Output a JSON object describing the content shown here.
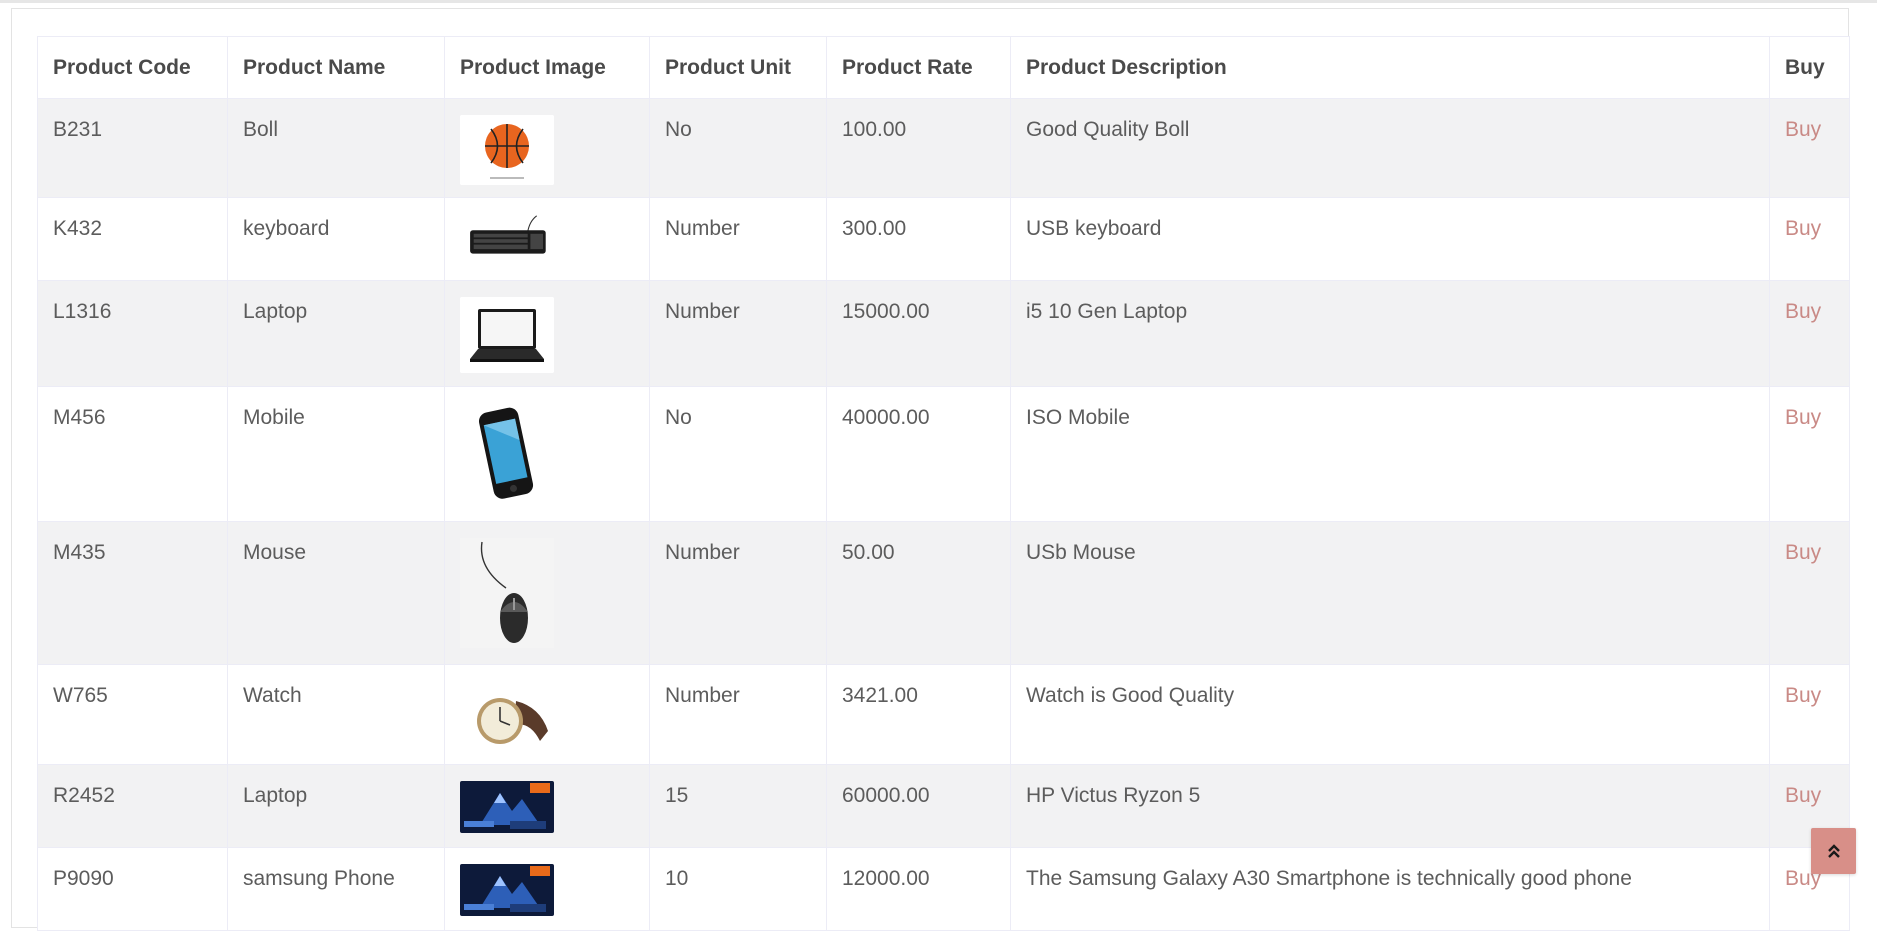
{
  "table": {
    "headers": [
      "Product Code",
      "Product Name",
      "Product Image",
      "Product Unit",
      "Product Rate",
      "Product Description",
      "Buy"
    ],
    "rows": [
      {
        "code": "B231",
        "name": "Boll",
        "image": "basketball",
        "unit": "No",
        "rate": "100.00",
        "description": "Good Quality Boll",
        "buy": "Buy"
      },
      {
        "code": "K432",
        "name": "keyboard",
        "image": "keyboard",
        "unit": "Number",
        "rate": "300.00",
        "description": "USB keyboard",
        "buy": "Buy"
      },
      {
        "code": "L1316",
        "name": "Laptop",
        "image": "laptop",
        "unit": "Number",
        "rate": "15000.00",
        "description": "i5 10 Gen Laptop",
        "buy": "Buy"
      },
      {
        "code": "M456",
        "name": "Mobile",
        "image": "smartphone",
        "unit": "No",
        "rate": "40000.00",
        "description": "ISO Mobile",
        "buy": "Buy"
      },
      {
        "code": "M435",
        "name": "Mouse",
        "image": "computer-mouse",
        "unit": "Number",
        "rate": "50.00",
        "description": "USb Mouse",
        "buy": "Buy"
      },
      {
        "code": "W765",
        "name": "Watch",
        "image": "wristwatch",
        "unit": "Number",
        "rate": "3421.00",
        "description": "Watch is Good Quality",
        "buy": "Buy"
      },
      {
        "code": "R2452",
        "name": "Laptop",
        "image": "laptop-box",
        "unit": "15",
        "rate": "60000.00",
        "description": "HP Victus Ryzon 5",
        "buy": "Buy"
      },
      {
        "code": "P9090",
        "name": "samsung Phone",
        "image": "laptop-box",
        "unit": "10",
        "rate": "12000.00",
        "description": "The Samsung Galaxy A30 Smartphone is technically good phone",
        "buy": "Buy"
      }
    ]
  },
  "scroll_top_icon": "double-chevron-up-icon",
  "colors": {
    "link": "#c98a86",
    "scroll_button": "#d88f88",
    "stripe": "#f2f2f3"
  }
}
